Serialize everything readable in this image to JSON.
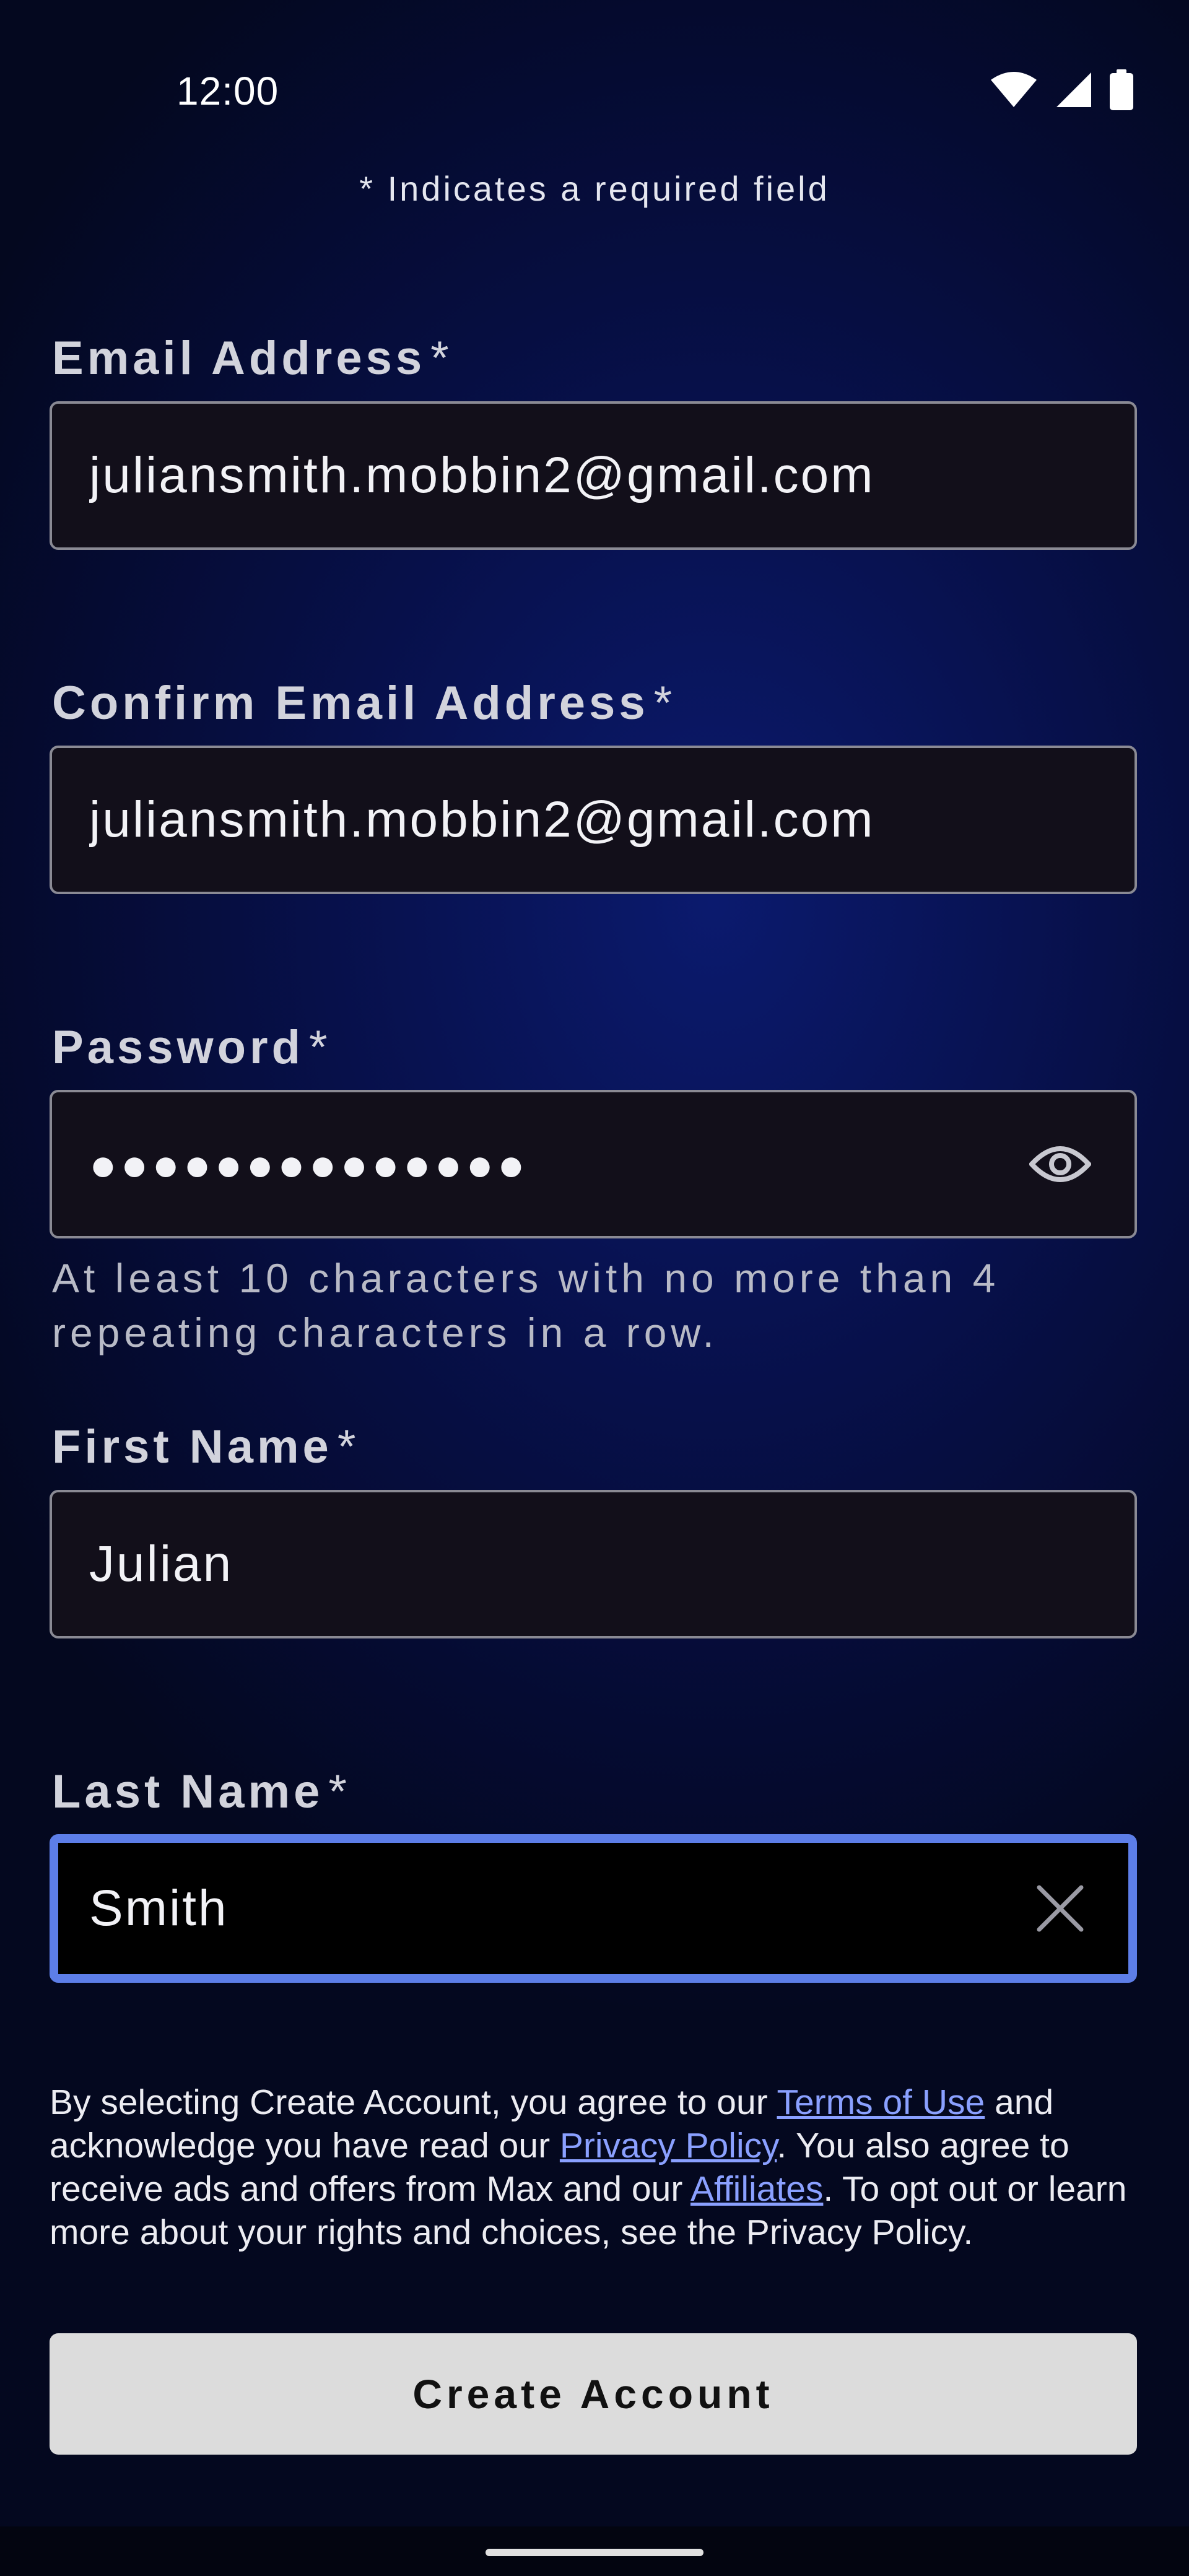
{
  "status_bar": {
    "time": "12:00",
    "icons": [
      "wifi-icon",
      "signal-icon",
      "battery-icon"
    ]
  },
  "form": {
    "required_note": "* Indicates a required field",
    "required_marker": "*",
    "email": {
      "label": "Email Address",
      "value": "juliansmith.mobbin2@gmail.com"
    },
    "confirm_email": {
      "label": "Confirm Email Address",
      "value": "juliansmith.mobbin2@gmail.com"
    },
    "password": {
      "label": "Password",
      "value": "●●●●●●●●●●●●●●",
      "helper": "At least 10 characters with no more than 4 repeating characters in a row.",
      "toggle_icon": "eye-icon"
    },
    "first_name": {
      "label": "First Name",
      "value": "Julian"
    },
    "last_name": {
      "label": "Last Name",
      "value": "Smith",
      "clear_icon": "close-icon"
    }
  },
  "legal": {
    "part1": "By selecting Create Account, you agree to our ",
    "terms_link": "Terms of Use",
    "part2": " and acknowledge you have read our ",
    "privacy_link": "Privacy Policy",
    "part3": ". You also agree to receive ads and offers from Max and our ",
    "affiliates_link": "Affiliates",
    "part4": ". To opt out or learn more about your rights and choices, see the Privacy Policy."
  },
  "actions": {
    "create_account_label": "Create Account"
  },
  "colors": {
    "background": "#07104a",
    "focus_border": "#5d7ee8",
    "link": "#8aa0ff",
    "button_bg": "#dcdcdc"
  }
}
